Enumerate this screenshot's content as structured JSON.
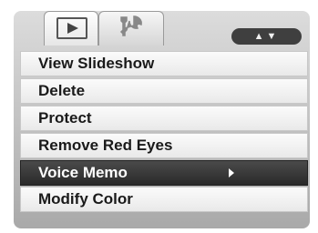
{
  "tabs": [
    {
      "name": "playback",
      "icon": "play-icon"
    },
    {
      "name": "setup",
      "icon": "wrench-screwdriver-icon"
    }
  ],
  "nav_arrows": "▲▼",
  "menu": {
    "items": [
      {
        "label": "View Slideshow",
        "selected": false
      },
      {
        "label": "Delete",
        "selected": false
      },
      {
        "label": "Protect",
        "selected": false
      },
      {
        "label": "Remove Red Eyes",
        "selected": false
      },
      {
        "label": "Voice Memo",
        "selected": true
      },
      {
        "label": "Modify Color",
        "selected": false
      }
    ]
  },
  "colors": {
    "selected_bg": "#2f2f2f",
    "item_bg": "#f4f4f4",
    "panel_bg": "#c4c4c4"
  }
}
